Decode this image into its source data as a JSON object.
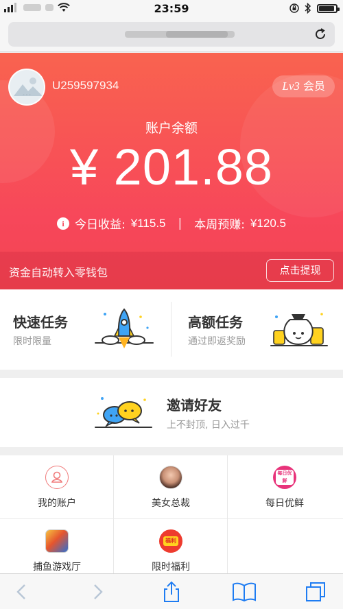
{
  "status_bar": {
    "time": "23:59"
  },
  "account": {
    "user_id": "U259597934",
    "level_prefix": "Lv3",
    "level_suffix": " 会员",
    "balance_label": "账户余额",
    "balance_amount": "¥ 201.88",
    "today_label": "今日收益:",
    "today_value": "¥115.5",
    "stat_divider": "|",
    "week_label": "本周预赚:",
    "week_value": "¥120.5",
    "transfer_text": "资金自动转入零钱包",
    "withdraw_label": "点击提现"
  },
  "tasks": [
    {
      "title": "快速任务",
      "subtitle": "限时限量",
      "icon": "rocket-icon"
    },
    {
      "title": "高额任务",
      "subtitle": "通过即返奖励",
      "icon": "money-bag-icon"
    }
  ],
  "invite": {
    "title": "邀请好友",
    "subtitle": "上不封顶, 日入过千",
    "icon": "chat-bubbles-icon"
  },
  "grid": [
    {
      "label": "我的账户",
      "icon": "user-icon"
    },
    {
      "label": "美女总裁",
      "icon": "game-avatar-icon"
    },
    {
      "label": "每日优鲜",
      "icon": "fresh-badge-icon",
      "badge_text": "每日优鲜"
    },
    {
      "label": "捕鱼游戏厅",
      "icon": "fishing-game-icon"
    },
    {
      "label": "限时福利",
      "icon": "welfare-icon",
      "badge_text": "福利"
    }
  ],
  "colors": {
    "hero_start": "#f9634f",
    "hero_end": "#f24452",
    "accent_yellow": "#ffd21f",
    "accent_blue": "#3fa4f5"
  }
}
